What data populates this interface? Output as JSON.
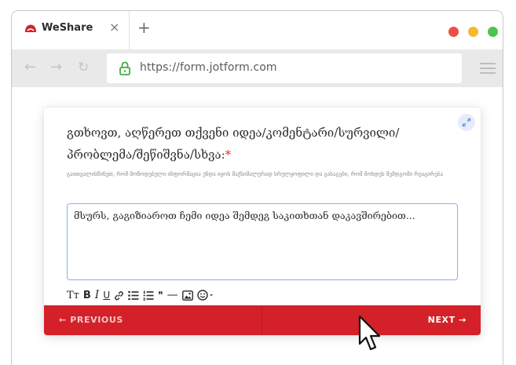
{
  "browser": {
    "tab_title": "WeShare",
    "tab_close": "×",
    "new_tab": "+",
    "url": "https://form.jotform.com",
    "nav_back": "←",
    "nav_forward": "→",
    "nav_reload": "↻",
    "window_controls": [
      "#f04e45",
      "#f5b82e",
      "#4fc34e"
    ]
  },
  "form": {
    "question": "გთხოვთ, აღწერეთ თქვენი იდეა/კომენტარი/სურვილი/პრობლემა/შეწიშვნა/სხვა:",
    "required_mark": "*",
    "subtext": "გაითვალისწინეთ, რომ მოწოდებული ინფორმაცია უნდა იყოს მაქსიმალურად სრულყოფილი და გასაგები, რომ მოხდეს შემდგომი რეაგირება",
    "answer_value": "მსურს, გაგიზიაროთ ჩემი იდეა შემდეგ საკითხთან დაკავშირებით...",
    "toolbar_icons": [
      "text-size-icon",
      "bold-icon",
      "italic-icon",
      "underline-icon",
      "link-icon",
      "bullet-list-icon",
      "numbered-list-icon",
      "quote-icon",
      "horizontal-rule-icon",
      "image-icon",
      "emoji-icon"
    ],
    "toolbar_labels": {
      "text_size": "Tт",
      "bold": "B",
      "italic": "I",
      "underline": "U",
      "quote": "❞",
      "hr": "—"
    },
    "prev_label": "← PREVIOUS",
    "next_label": "NEXT →"
  },
  "colors": {
    "brand_red": "#d42028",
    "input_border": "#8ab0e6",
    "required": "#e02d2d"
  }
}
